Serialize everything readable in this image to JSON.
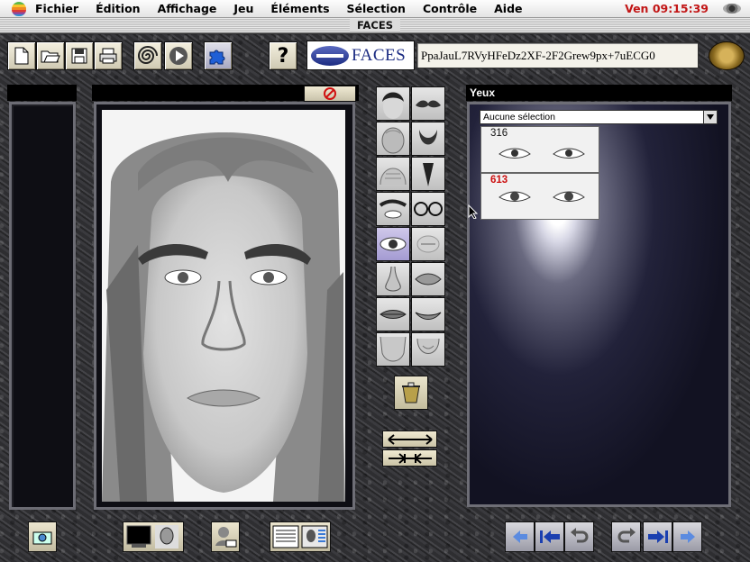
{
  "menubar": {
    "items": [
      "Fichier",
      "Édition",
      "Affichage",
      "Jeu",
      "Éléments",
      "Sélection",
      "Contrôle",
      "Aide"
    ],
    "clock": "Ven 09:15:39"
  },
  "window": {
    "title": "FACES"
  },
  "toolbar": {
    "logo_text": "FACES",
    "code": "PpaJauL7RVyHFeDz2XF-2F2Grew9px+7uECG0"
  },
  "right_panel": {
    "title": "Yeux",
    "dropdown_value": "Aucune sélection",
    "thumbnails": [
      {
        "number": "316",
        "color": "#111111"
      },
      {
        "number": "613",
        "color": "#cc1111"
      }
    ]
  },
  "features": [
    "hair",
    "mustache",
    "head-shape",
    "beard",
    "forehead",
    "chin-beard",
    "eyebrows",
    "glasses",
    "eyes",
    "misc",
    "nose",
    "lips",
    "mouth",
    "smile",
    "jaw",
    "chin"
  ],
  "selected_feature": "eyes"
}
